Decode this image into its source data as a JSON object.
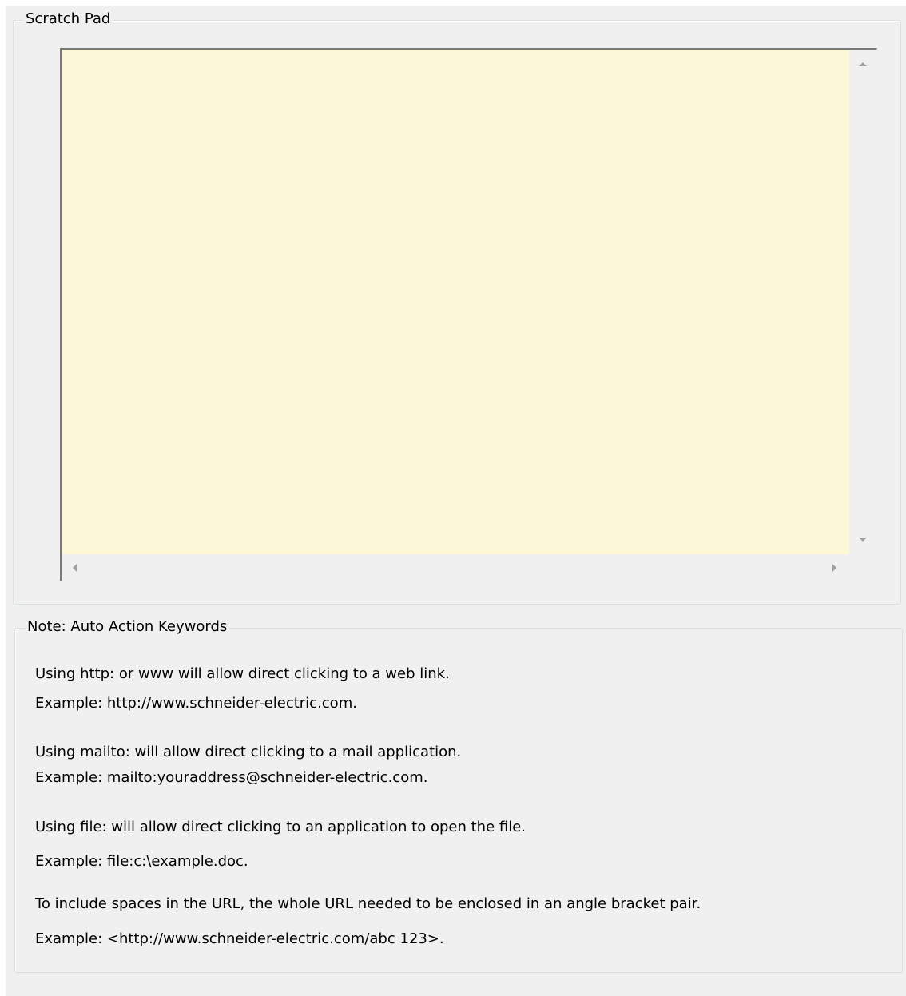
{
  "scratch_pad": {
    "title": "Scratch Pad",
    "content": "",
    "background_color": "#fcf7d7"
  },
  "note": {
    "title": "Note: Auto Action Keywords",
    "lines": [
      "Using http: or www will allow direct clicking to a web link.",
      "Example:  http://www.schneider-electric.com.",
      "Using mailto: will allow direct clicking to a mail application.",
      "Example:  mailto:youraddress@schneider-electric.com.",
      "Using file: will allow direct clicking to an application to open the file.",
      "Example:  file:c:\\example.doc.",
      "To include spaces in the URL, the whole URL needed to be enclosed in an angle bracket pair.",
      "Example: <http://www.schneider-electric.com/abc 123>."
    ]
  }
}
